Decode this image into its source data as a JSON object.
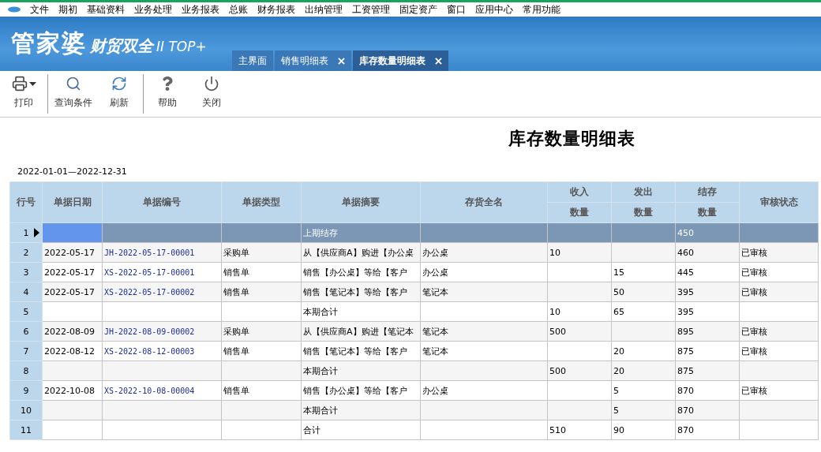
{
  "menu": [
    "文件",
    "期初",
    "基础资料",
    "业务处理",
    "业务报表",
    "总账",
    "财务报表",
    "出纳管理",
    "工资管理",
    "固定资产",
    "窗口",
    "应用中心",
    "常用功能"
  ],
  "logo": {
    "main": "管家婆",
    "sub": "财贸双全",
    "edition": "II TOP+"
  },
  "tabs": [
    {
      "label": "主界面",
      "selected": false,
      "closable": false
    },
    {
      "label": "销售明细表",
      "selected": false,
      "closable": true
    },
    {
      "label": "库存数量明细表",
      "selected": true,
      "closable": true
    }
  ],
  "toolbar": [
    [
      {
        "label": "打印",
        "kind": "print",
        "dropdown": true
      }
    ],
    [
      {
        "label": "查询条件",
        "kind": "search",
        "dropdown": false
      },
      {
        "label": "刷新",
        "kind": "refresh",
        "dropdown": false
      }
    ],
    [
      {
        "label": "帮助",
        "kind": "help",
        "dropdown": false
      },
      {
        "label": "关闭",
        "kind": "power",
        "dropdown": false
      }
    ]
  ],
  "report": {
    "title": "库存数量明细表",
    "date_range": "2022-01-01—2022-12-31"
  },
  "table": {
    "columns": [
      {
        "label": "行号",
        "kind": "rownum"
      },
      {
        "label": "单据日期",
        "kind": "text"
      },
      {
        "label": "单据编号",
        "kind": "link"
      },
      {
        "label": "单据类型",
        "kind": "text"
      },
      {
        "label": "单据摘要",
        "kind": "text"
      },
      {
        "label": "存货全名",
        "kind": "text"
      },
      {
        "group": "收入",
        "label": "数量",
        "kind": "text"
      },
      {
        "group": "发出",
        "label": "数量",
        "kind": "text"
      },
      {
        "group": "结存",
        "label": "数量",
        "kind": "text"
      },
      {
        "label": "审核状态",
        "kind": "text"
      }
    ],
    "rows": [
      {
        "selected": true,
        "cells": [
          "1",
          "",
          "",
          "",
          "上期结存",
          "",
          "",
          "",
          "450",
          ""
        ]
      },
      {
        "selected": false,
        "cells": [
          "2",
          "2022-05-17",
          "JH-2022-05-17-00001",
          "采购单",
          "从【供应商A】购进【办公桌",
          "办公桌",
          "10",
          "",
          "460",
          "已审核"
        ]
      },
      {
        "selected": false,
        "cells": [
          "3",
          "2022-05-17",
          "XS-2022-05-17-00001",
          "销售单",
          "销售【办公桌】等给【客户",
          "办公桌",
          "",
          "15",
          "445",
          "已审核"
        ]
      },
      {
        "selected": false,
        "cells": [
          "4",
          "2022-05-17",
          "XS-2022-05-17-00002",
          "销售单",
          "销售【笔记本】等给【客户",
          "笔记本",
          "",
          "50",
          "395",
          "已审核"
        ]
      },
      {
        "selected": false,
        "cells": [
          "5",
          "",
          "",
          "",
          "本期合计",
          "",
          "10",
          "65",
          "395",
          ""
        ]
      },
      {
        "selected": false,
        "cells": [
          "6",
          "2022-08-09",
          "JH-2022-08-09-00002",
          "采购单",
          "从【供应商A】购进【笔记本",
          "笔记本",
          "500",
          "",
          "895",
          "已审核"
        ]
      },
      {
        "selected": false,
        "cells": [
          "7",
          "2022-08-12",
          "XS-2022-08-12-00003",
          "销售单",
          "销售【笔记本】等给【客户",
          "笔记本",
          "",
          "20",
          "875",
          "已审核"
        ]
      },
      {
        "selected": false,
        "cells": [
          "8",
          "",
          "",
          "",
          "本期合计",
          "",
          "500",
          "20",
          "875",
          ""
        ]
      },
      {
        "selected": false,
        "cells": [
          "9",
          "2022-10-08",
          "XS-2022-10-08-00004",
          "销售单",
          "销售【办公桌】等给【客户",
          "办公桌",
          "",
          "5",
          "870",
          "已审核"
        ]
      },
      {
        "selected": false,
        "cells": [
          "10",
          "",
          "",
          "",
          "本期合计",
          "",
          "",
          "5",
          "870",
          ""
        ]
      },
      {
        "selected": false,
        "cells": [
          "11",
          "",
          "",
          "",
          "合计",
          "",
          "510",
          "90",
          "870",
          ""
        ]
      }
    ]
  }
}
